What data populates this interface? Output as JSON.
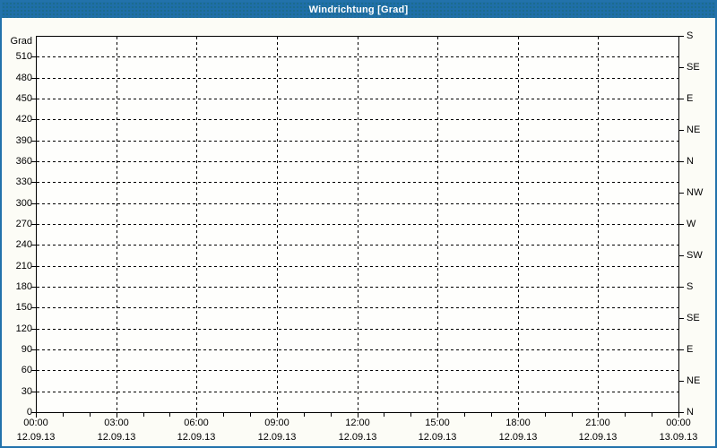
{
  "window": {
    "title": "Windrichtung [Grad]"
  },
  "colors": {
    "titlebar_bg": "#1f6fa8",
    "titlebar_text": "#ffffff",
    "frame_border": "#2272ab",
    "page_bg": "#fcfcf6",
    "plot_bg": "#fefefc",
    "grid": "#000000",
    "axis": "#000000",
    "text": "#000000"
  },
  "chart_data": {
    "type": "line",
    "title": "Windrichtung [Grad]",
    "series": [],
    "grid": {
      "style": "dashed",
      "h_step_deg": 30,
      "v_step_hours": 3
    },
    "y_axis_left": {
      "label": "Grad",
      "min": 0,
      "max": 540,
      "tick_step": 30,
      "tick_labels": [
        "0",
        "30",
        "60",
        "90",
        "120",
        "150",
        "180",
        "210",
        "240",
        "270",
        "300",
        "330",
        "360",
        "390",
        "420",
        "450",
        "480",
        "510"
      ]
    },
    "y_axis_right": {
      "tick_step_deg": 45,
      "tick_values_top_to_bottom": [
        540,
        495,
        450,
        405,
        360,
        315,
        270,
        225,
        180,
        135,
        90,
        45,
        0
      ],
      "labels_top_to_bottom": [
        "S",
        "SE",
        "E",
        "NE",
        "N",
        "NW",
        "W",
        "SW",
        "S",
        "SE",
        "E",
        "NE",
        "N"
      ]
    },
    "x_axis": {
      "range_hours": [
        0,
        24
      ],
      "major_step_hours": 3,
      "minor_step_hours": 1,
      "major_ticks": [
        {
          "time": "00:00",
          "date": "12.09.13"
        },
        {
          "time": "03:00",
          "date": "12.09.13"
        },
        {
          "time": "06:00",
          "date": "12.09.13"
        },
        {
          "time": "09:00",
          "date": "12.09.13"
        },
        {
          "time": "12:00",
          "date": "12.09.13"
        },
        {
          "time": "15:00",
          "date": "12.09.13"
        },
        {
          "time": "18:00",
          "date": "12.09.13"
        },
        {
          "time": "21:00",
          "date": "12.09.13"
        },
        {
          "time": "00:00",
          "date": "13.09.13"
        }
      ]
    }
  }
}
